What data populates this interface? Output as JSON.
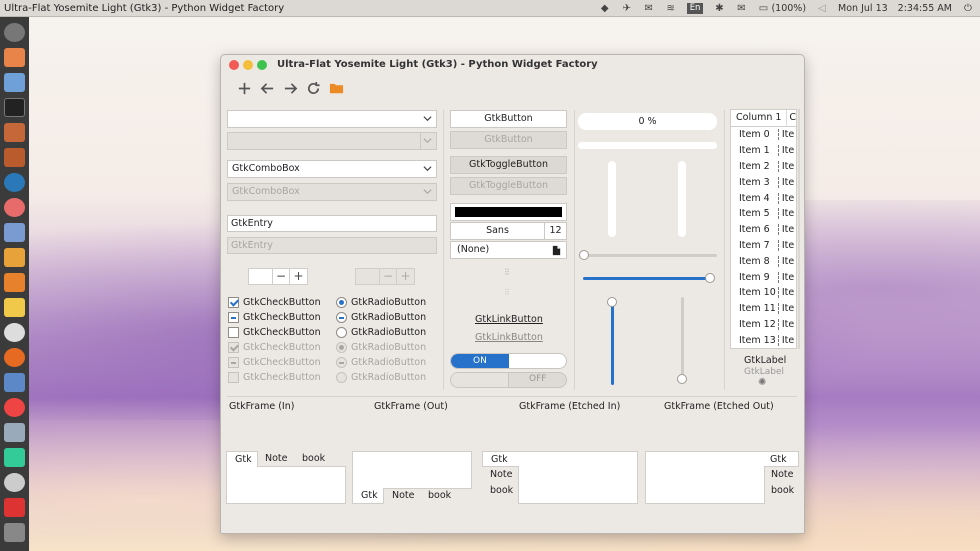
{
  "topbar": {
    "app_title": "Ultra-Flat Yosemite Light (Gtk3) - Python Widget Factory",
    "battery": "(100%)",
    "keyboard_layout": "En",
    "date": "Mon Jul 13",
    "time": "2:34:55 AM"
  },
  "window": {
    "title": "Ultra-Flat Yosemite Light (Gtk3) - Python Widget Factory",
    "toolbar": [
      "add-icon",
      "back-icon",
      "forward-icon",
      "refresh-icon",
      "folder-icon"
    ]
  },
  "col1": {
    "combo_box_label": "GtkComboBox",
    "entry_text": "GtkEntry",
    "checks": [
      "GtkCheckButton",
      "GtkCheckButton",
      "GtkCheckButton",
      "GtkCheckButton",
      "GtkCheckButton",
      "GtkCheckButton"
    ],
    "radios": [
      "GtkRadioButton",
      "GtkRadioButton",
      "GtkRadioButton",
      "GtkRadioButton",
      "GtkRadioButton",
      "GtkRadioButton"
    ]
  },
  "col2": {
    "button": "GtkButton",
    "toggle_button": "GtkToggleButton",
    "color": "#000000",
    "font_name": "Sans",
    "font_size": "12",
    "file_none": "(None)",
    "link_button": "GtkLinkButton",
    "switch_on": "ON",
    "switch_off": "OFF"
  },
  "col3": {
    "progress_text": "0 %",
    "progress_value": 0,
    "hscale_1_value": 0,
    "hscale_2_value": 1,
    "vscale_1_value": 0,
    "vscale_2_value": 1
  },
  "tree": {
    "columns": [
      "Column 1",
      "C"
    ],
    "items": [
      "Item 0",
      "Item 1",
      "Item 2",
      "Item 3",
      "Item 4",
      "Item 5",
      "Item 6",
      "Item 7",
      "Item 8",
      "Item 9",
      "Item 10",
      "Item 11",
      "Item 12",
      "Item 13"
    ],
    "col2_text": "Ite"
  },
  "labels": {
    "label": "GtkLabel"
  },
  "frames": {
    "frame_in": "GtkFrame (In)",
    "frame_out": "GtkFrame (Out)",
    "frame_etched_in": "GtkFrame (Etched In)",
    "frame_etched_out": "GtkFrame (Etched Out)"
  },
  "notebook": {
    "tabs": [
      "Gtk",
      "Note",
      "book"
    ]
  }
}
